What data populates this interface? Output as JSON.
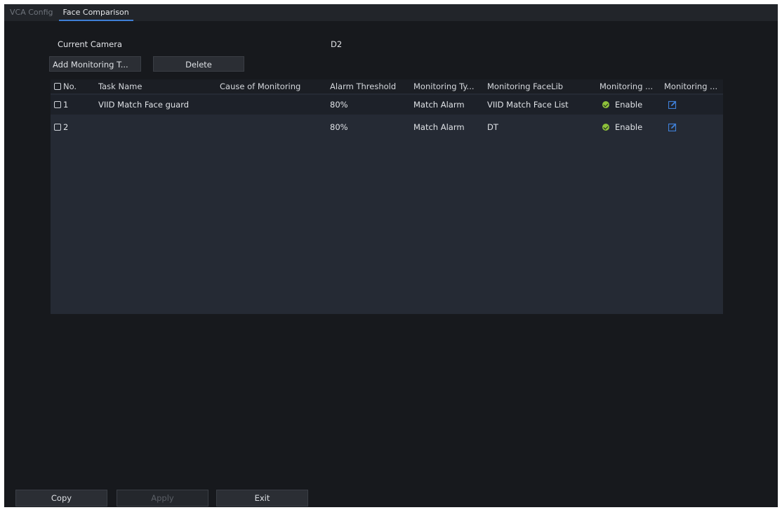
{
  "tabs": [
    {
      "label": "VCA Config",
      "active": false
    },
    {
      "label": "Face Comparison",
      "active": true
    }
  ],
  "camera": {
    "label": "Current Camera",
    "value": "D2"
  },
  "toolbar": {
    "add_label": "Add Monitoring T...",
    "delete_label": "Delete"
  },
  "table": {
    "headers": {
      "no": "No.",
      "task_name": "Task Name",
      "cause": "Cause of Monitoring",
      "threshold": "Alarm Threshold",
      "type": "Monitoring Ty...",
      "facelib": "Monitoring FaceLib",
      "status": "Monitoring ...",
      "edit": "Monitoring ..."
    },
    "rows": [
      {
        "no": "1",
        "task_name": "VIID Match Face guard",
        "cause": "",
        "threshold": "80%",
        "type": "Match Alarm",
        "facelib": "VIID Match Face List",
        "status": "Enable"
      },
      {
        "no": "2",
        "task_name": "",
        "cause": "",
        "threshold": "80%",
        "type": "Match Alarm",
        "facelib": "DT",
        "status": "Enable"
      }
    ]
  },
  "footer": {
    "copy_label": "Copy",
    "apply_label": "Apply",
    "exit_label": "Exit"
  },
  "icons": {
    "status": "check-circle-icon",
    "edit": "edit-icon"
  },
  "colors": {
    "accent": "#3f7fd6",
    "status_ok": "#8ec23a",
    "background": "#17191d"
  }
}
